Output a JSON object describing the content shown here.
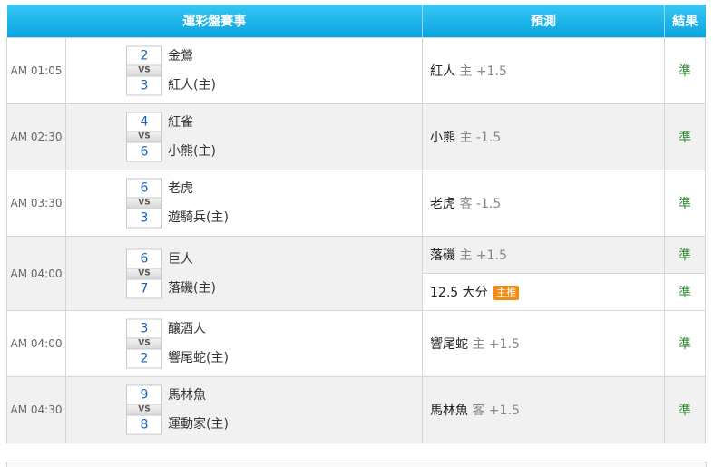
{
  "header": {
    "col_match": "運彩盤賽事",
    "col_pred": "預測",
    "col_result": "結果"
  },
  "vs_label": "VS",
  "games": [
    {
      "time": "AM 01:05",
      "away_score": "2",
      "home_score": "3",
      "away": "金鶯",
      "home": "紅人(主)",
      "preds": [
        {
          "team": "紅人",
          "side": "主",
          "line": "+1.5",
          "badge": "",
          "result": "準"
        }
      ]
    },
    {
      "time": "AM 02:30",
      "away_score": "4",
      "home_score": "6",
      "away": "紅雀",
      "home": "小熊(主)",
      "preds": [
        {
          "team": "小熊",
          "side": "主",
          "line": "-1.5",
          "badge": "",
          "result": "準"
        }
      ]
    },
    {
      "time": "AM 03:30",
      "away_score": "6",
      "home_score": "3",
      "away": "老虎",
      "home": "遊騎兵(主)",
      "preds": [
        {
          "team": "老虎",
          "side": "客",
          "line": "-1.5",
          "badge": "",
          "result": "準"
        }
      ]
    },
    {
      "time": "AM 04:00",
      "away_score": "6",
      "home_score": "7",
      "away": "巨人",
      "home": "落磯(主)",
      "preds": [
        {
          "team": "落磯",
          "side": "主",
          "line": "+1.5",
          "badge": "",
          "result": "準"
        },
        {
          "team": "12.5 大分",
          "side": "",
          "line": "",
          "badge": "主推",
          "result": "準"
        }
      ]
    },
    {
      "time": "AM 04:00",
      "away_score": "3",
      "home_score": "2",
      "away": "釀酒人",
      "home": "響尾蛇(主)",
      "preds": [
        {
          "team": "響尾蛇",
          "side": "主",
          "line": "+1.5",
          "badge": "",
          "result": "準"
        }
      ]
    },
    {
      "time": "AM 04:30",
      "away_score": "9",
      "home_score": "8",
      "away": "馬林魚",
      "home": "運動家(主)",
      "preds": [
        {
          "team": "馬林魚",
          "side": "客",
          "line": "+1.5",
          "badge": "",
          "result": "準"
        }
      ]
    }
  ]
}
